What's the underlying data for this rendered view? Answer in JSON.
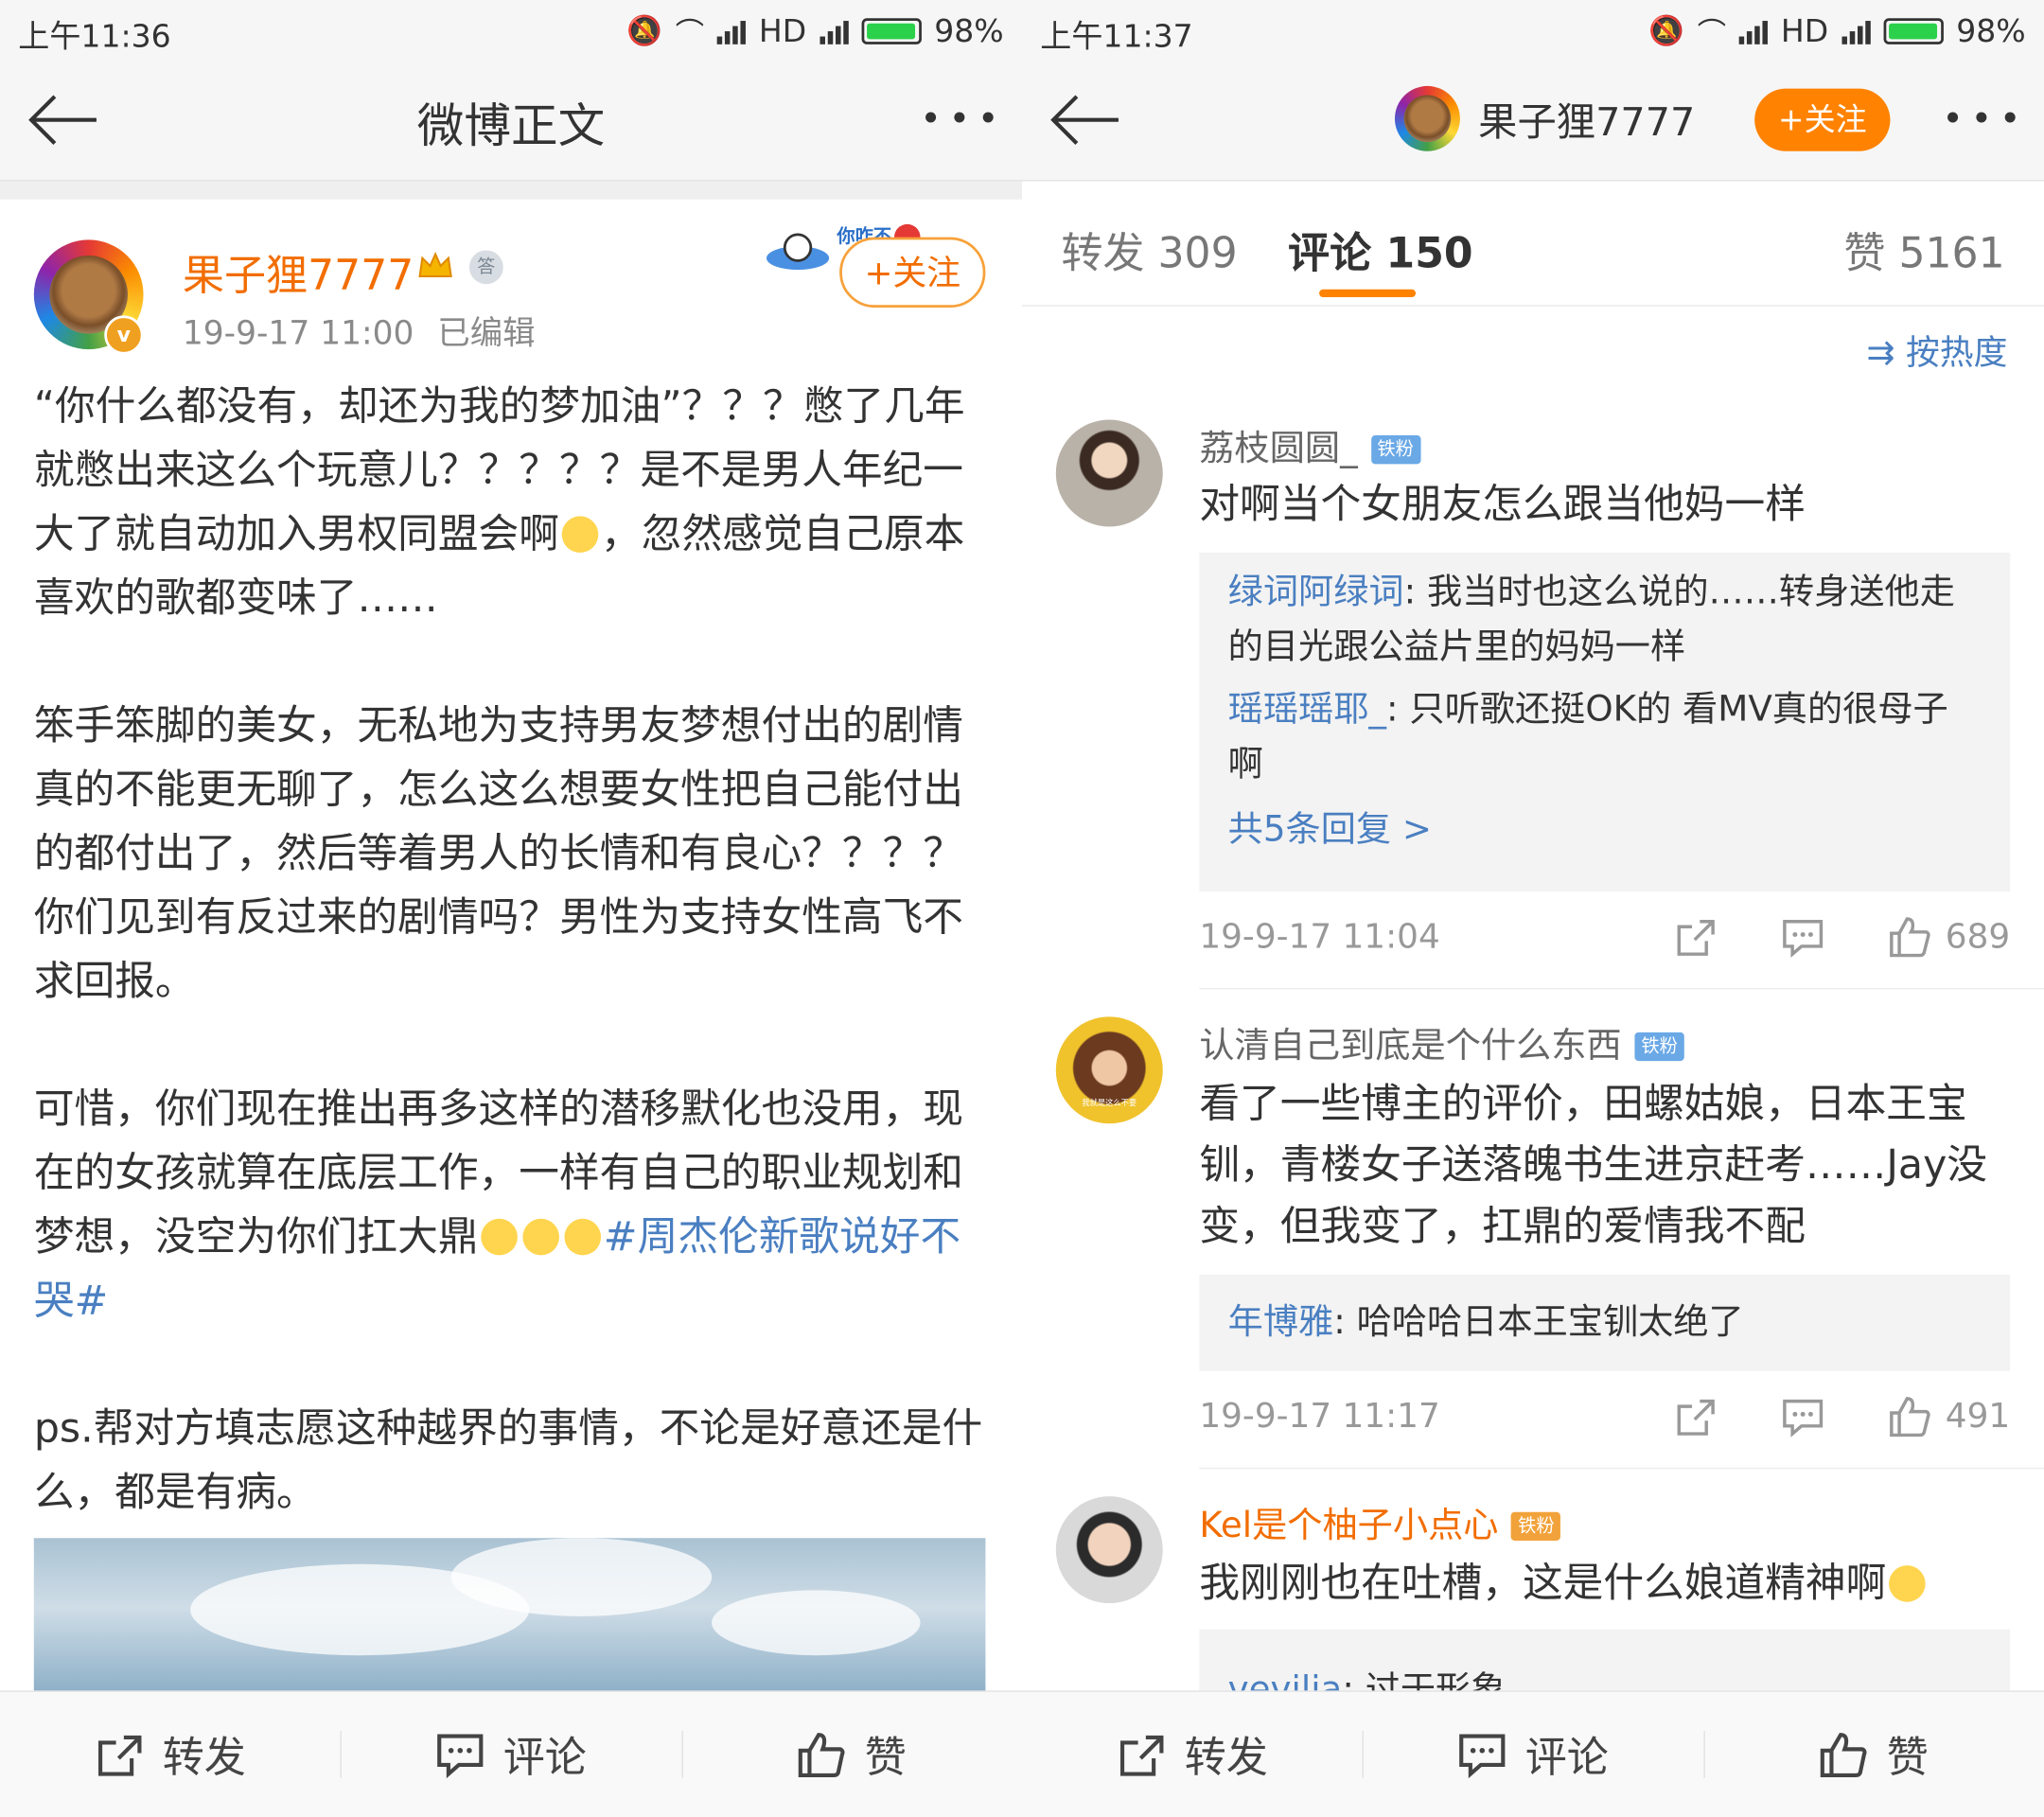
{
  "left": {
    "status": {
      "time": "上午11:36",
      "network": "HD",
      "battery": "98%",
      "battery_fraction": 0.98
    },
    "header": {
      "title": "微博正文"
    },
    "post": {
      "author": "果子狸7777",
      "medal_label": "答",
      "time": "19-9-17 11:00",
      "edited": "已编辑",
      "follow_label": "+关注",
      "sticker_text": "你咋不上",
      "paragraphs": [
        {
          "text": "“你什么都没有，却还为我的梦加油”？？？憋了几年就憋出来这么个玩意儿？？？？？是不是男人年纪一大了就自动加入男权同盟会啊",
          "tail": "，忽然感觉自己原本喜欢的歌都变味了……"
        },
        {
          "text": "笨手笨脚的美女，无私地为支持男友梦想付出的剧情真的不能更无聊了，怎么这么想要女性把自己能付出的都付出了，然后等着男人的长情和有良心？？？？你们见到有反过来的剧情吗？男性为支持女性高飞不求回报。"
        },
        {
          "text": "可惜，你们现在推出再多这样的潜移默化也没用，现在的女孩就算在底层工作，一样有自己的职业规划和梦想，没空为你们扛大鼎",
          "hashtag": "#周杰伦新歌说好不哭#"
        },
        {
          "text": "ps.帮对方填志愿这种越界的事情，不论是好意还是什么，都是有病。"
        }
      ]
    },
    "bottombar": {
      "repost": "转发",
      "comment": "评论",
      "like": "赞"
    }
  },
  "right": {
    "status": {
      "time": "上午11:37",
      "network": "HD",
      "battery": "98%",
      "battery_fraction": 0.98
    },
    "header": {
      "author": "果子狸7777",
      "follow_label": "+关注"
    },
    "tabs": {
      "repost": "转发 309",
      "comment": "评论 150",
      "like": "赞 5161"
    },
    "sort_label": "按热度",
    "comments": [
      {
        "name": "荔枝圆圆_",
        "tag": "铁粉",
        "text": "对啊当个女朋友怎么跟当他妈一样",
        "replies": [
          {
            "name": "绿词阿绿词",
            "text": ": 我当时也这么说的……转身送他走的目光跟公益片里的妈妈一样"
          },
          {
            "name": "瑶瑶瑶耶_",
            "text": ": 只听歌还挺OK的  看MV真的很母子啊"
          }
        ],
        "more_replies": "共5条回复 >",
        "time": "19-9-17 11:04",
        "likes": "689"
      },
      {
        "name": "认清自己到底是个什么东西",
        "tag": "铁粉",
        "text": "看了一些博主的评价，田螺姑娘，日本王宝钏，青楼女子送落魄书生进京赶考……Jay没变，但我变了，扛鼎的爱情我不配",
        "avatar_caption": "我就是这么不要",
        "replies": [
          {
            "name": "年博雅",
            "text": ": 哈哈哈日本王宝钏太绝了"
          }
        ],
        "time": "19-9-17 11:17",
        "likes": "491"
      },
      {
        "name": "Kel是个柚子小点心",
        "tag": "铁粉",
        "text": "我刚刚也在吐槽，这是什么娘道精神啊",
        "replies": [
          {
            "name": "vevilia",
            "text": ": 过于形象"
          }
        ]
      }
    ],
    "bottombar": {
      "repost": "转发",
      "comment": "评论",
      "like": "赞"
    }
  }
}
